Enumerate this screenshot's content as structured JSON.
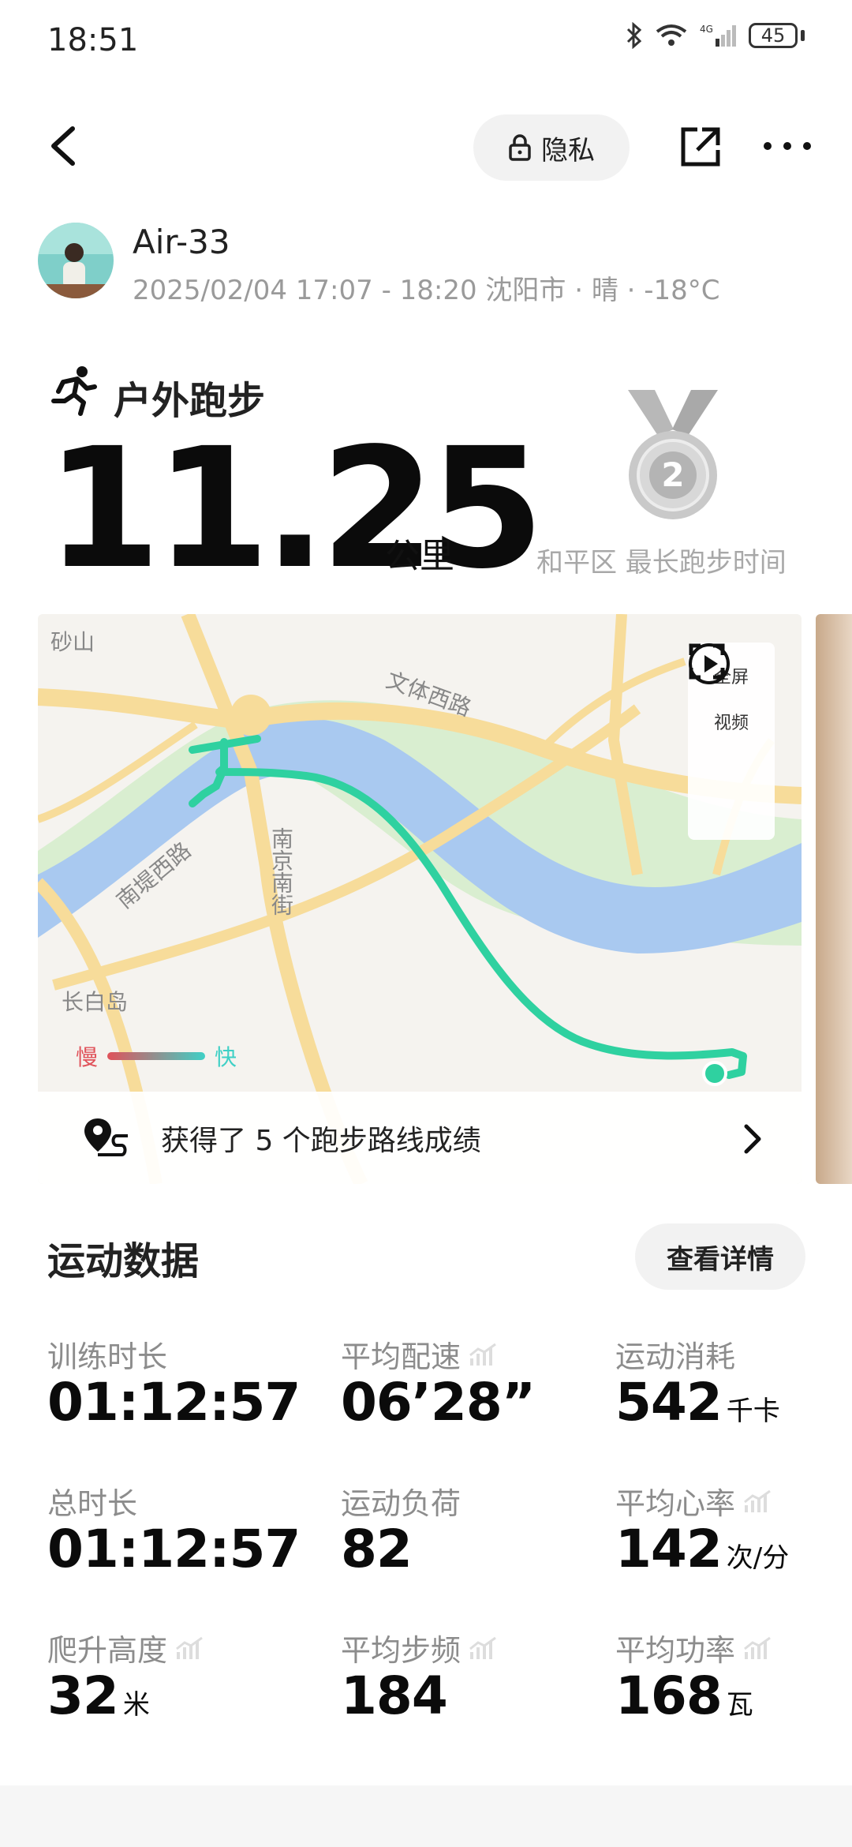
{
  "status_bar": {
    "time": "18:51",
    "battery": "45",
    "network": "4G"
  },
  "header": {
    "privacy_label": "隐私"
  },
  "user": {
    "name": "Air-33",
    "meta": "2025/02/04 17:07 - 18:20 沈阳市 · 晴 · -18°C"
  },
  "activity": {
    "type": "户外跑步",
    "distance": "11.25",
    "distance_unit": "公里",
    "medal_rank": "2",
    "medal_caption": "和平区 最长跑步时间"
  },
  "map": {
    "labels": [
      "砂山",
      "文体西路",
      "南京南街",
      "南堤西路",
      "长白岛"
    ],
    "fullscreen_label": "全屏",
    "video_label": "视频",
    "speed_slow": "慢",
    "speed_fast": "快",
    "achievement_text": "获得了 5 个跑步路线成绩"
  },
  "stats": {
    "section_title": "运动数据",
    "details_button": "查看详情",
    "items": [
      {
        "label": "训练时长",
        "value": "01:12:57",
        "unit": ""
      },
      {
        "label": "平均配速",
        "value": "06’28”",
        "unit": ""
      },
      {
        "label": "运动消耗",
        "value": "542",
        "unit": "千卡"
      },
      {
        "label": "总时长",
        "value": "01:12:57",
        "unit": ""
      },
      {
        "label": "运动负荷",
        "value": "82",
        "unit": ""
      },
      {
        "label": "平均心率",
        "value": "142",
        "unit": "次/分"
      },
      {
        "label": "爬升高度",
        "value": "32",
        "unit": "米"
      },
      {
        "label": "平均步频",
        "value": "184",
        "unit": ""
      },
      {
        "label": "平均功率",
        "value": "168",
        "unit": "瓦"
      }
    ]
  },
  "colors": {
    "accent_route": "#2fd1a0",
    "river": "#a9c9f0",
    "road": "#f7dc9a",
    "speed_slow": "#e0525a",
    "speed_fast": "#3fd0c6"
  }
}
